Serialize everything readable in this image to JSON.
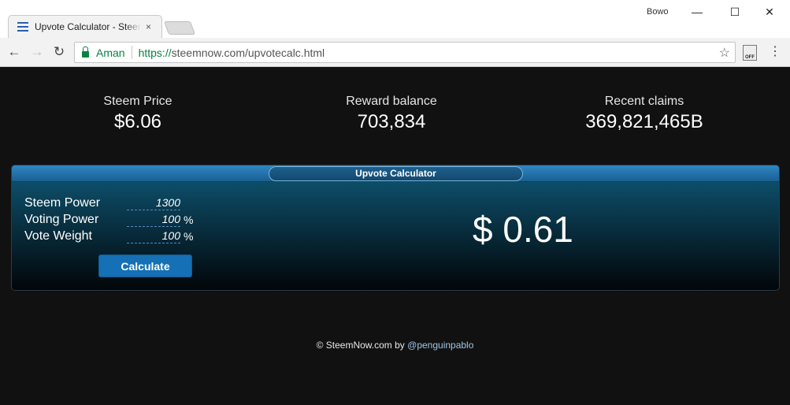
{
  "browser": {
    "tab_title": "Upvote Calculator - SteemNow",
    "tab_close": "×",
    "profile_name": "Bowo",
    "secure_label": "Aman",
    "url_scheme": "https://",
    "url_rest": "steemnow.com/upvotecalc.html",
    "extension_label": "OFF"
  },
  "stats": [
    {
      "label": "Steem Price",
      "value": "$6.06"
    },
    {
      "label": "Reward balance",
      "value": "703,834"
    },
    {
      "label": "Recent claims",
      "value": "369,821,465B"
    }
  ],
  "calculator": {
    "title": "Upvote Calculator",
    "fields": [
      {
        "label": "Steem Power",
        "value": "1300",
        "unit": ""
      },
      {
        "label": "Voting Power",
        "value": "100",
        "unit": "%"
      },
      {
        "label": "Vote Weight",
        "value": "100",
        "unit": "%"
      }
    ],
    "button_label": "Calculate",
    "result": "$ 0.61"
  },
  "footer": {
    "text": "© SteemNow.com by ",
    "link": "@penguinpablo"
  }
}
